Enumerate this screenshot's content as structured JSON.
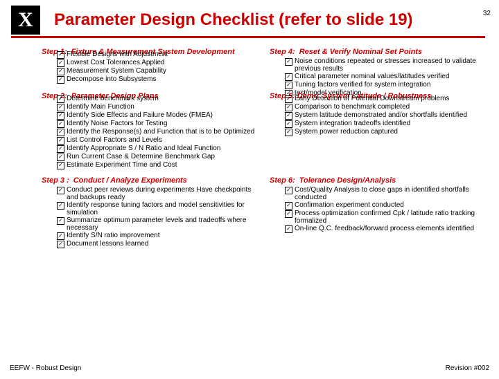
{
  "page_number": "32",
  "title": "Parameter Design Checklist (refer to slide 19)",
  "footer_left": "EEFW - Robust Design",
  "footer_right": "Revision #002",
  "step1": {
    "num": "Step 1:",
    "title": "Fixture & Measurement System Development",
    "items": [
      "Flexible Designs with Adjustment",
      "Lowest Cost Tolerances Applied",
      "Measurement System Capability",
      "Decompose into Subsystems"
    ]
  },
  "step2": {
    "num": "Step 2:",
    "title": "Parameter Design Plans",
    "items": [
      "Determine benchmark system",
      "Identify Main Function",
      "Identify Side Effects and Failure Modes (FMEA)",
      "Identify Noise Factors for Testing",
      "Identify the Response(s) and Function that is to be Optimized",
      "List Control Factors and Levels",
      "Identify Appropriate S / N Ratio and Ideal Function",
      "Run Current Case & Determine Benchmark Gap",
      "Estimate Experiment Time and Cost"
    ]
  },
  "step3": {
    "num": "Step 3 :",
    "title": "Conduct / Analyze Experiments",
    "items": [
      "Conduct peer reviews during experiments Have checkpoints and backups ready",
      "Identify response tuning factors and  model sensitivities for simulation",
      "Summarize optimum parameter levels  and tradeoffs where necessary",
      "Identify S/N ratio improvement",
      "Document lessons learned"
    ]
  },
  "step4": {
    "num": "Step 4:",
    "title": "Reset & Verify Nominal Set Points",
    "items": [
      "Noise conditions repeated or stresses increased to    validate previous results",
      "Critical parameter nominal values/latitudes verified",
      "Tuning factors verified for system integration",
      "test/model verification"
    ]
  },
  "step5": {
    "num": "Step 5: Demo",
    "title": "System Latitude / Robustness",
    "items": [
      "Early Detection of Potential Downstream problems",
      "Comparison to benchmark completed",
      "System latitude demonstrated and/or shortfalls identified",
      "System integration tradeoffs identified",
      "System power reduction captured"
    ]
  },
  "step6": {
    "num": "Step 6:",
    "title": "Tolerance Design/Analysis",
    "items": [
      "Cost/Quality Analysis to close gaps in identified shortfalls conducted",
      "Confirmation experiment conducted",
      "Process optimization confirmed Cpk / latitude ratio tracking formalized",
      "On-line Q.C. feedback/forward process elements identified"
    ]
  }
}
